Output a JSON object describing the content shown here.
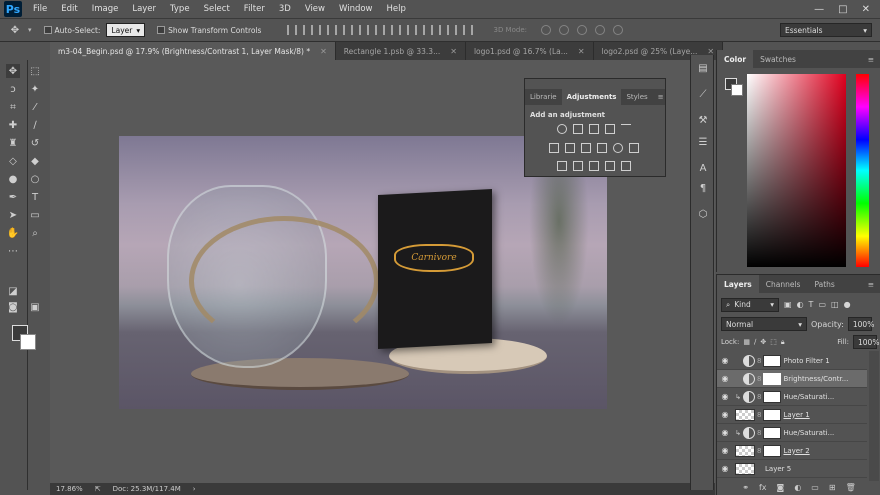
{
  "app": {
    "logo": "Ps"
  },
  "menu": [
    "File",
    "Edit",
    "Image",
    "Layer",
    "Type",
    "Select",
    "Filter",
    "3D",
    "View",
    "Window",
    "Help"
  ],
  "window_controls": {
    "minimize": "—",
    "restore": "□",
    "close": "✕"
  },
  "options": {
    "auto_select_label": "Auto-Select:",
    "auto_select_value": "Layer",
    "transform_label": "Show Transform Controls",
    "mode_3d_label": "3D Mode:",
    "workspace": "Essentials"
  },
  "tabs": [
    {
      "label": "m3-04_Begin.psd @ 17.9% (Brightness/Contrast 1, Layer Mask/8) *",
      "active": true
    },
    {
      "label": "Rectangle 1.psb @ 33.3...",
      "active": false
    },
    {
      "label": "logo1.psd @ 16.7% (La...",
      "active": false
    },
    {
      "label": "logo2.psd @ 25% (Laye...",
      "active": false
    }
  ],
  "canvas": {
    "bag_logo_text": "Carnivore"
  },
  "status": {
    "zoom": "17.86%",
    "doc": "Doc: 25.3M/117.4M"
  },
  "adjustments": {
    "tabs": [
      "Librarie",
      "Adjustments",
      "Styles"
    ],
    "active_tab": "Adjustments",
    "title": "Add an adjustment"
  },
  "color_panel": {
    "tabs": [
      "Color",
      "Swatches"
    ],
    "accent": "#e0001e"
  },
  "layers_panel": {
    "tabs": [
      "Layers",
      "Channels",
      "Paths"
    ],
    "filter_kind": "Kind",
    "blend_mode": "Normal",
    "opacity_label": "Opacity:",
    "opacity_value": "100%",
    "lock_label": "Lock:",
    "fill_label": "Fill:",
    "fill_value": "100%",
    "layers": [
      {
        "name": "Photo Filter 1",
        "type": "adjustment",
        "selected": false,
        "clipped": false,
        "underline": false
      },
      {
        "name": "Brightness/Contr...",
        "type": "adjustment",
        "selected": true,
        "clipped": false,
        "underline": false
      },
      {
        "name": "Hue/Saturati...",
        "type": "adjustment",
        "selected": false,
        "clipped": true,
        "underline": false
      },
      {
        "name": "Layer 1",
        "type": "pixel",
        "selected": false,
        "clipped": false,
        "underline": true
      },
      {
        "name": "Hue/Saturati...",
        "type": "adjustment",
        "selected": false,
        "clipped": true,
        "underline": false
      },
      {
        "name": "Layer 2",
        "type": "pixel",
        "selected": false,
        "clipped": false,
        "underline": true
      },
      {
        "name": "Layer 5",
        "type": "pixel",
        "selected": false,
        "clipped": false,
        "underline": false
      }
    ],
    "footer_fx": "fx"
  }
}
